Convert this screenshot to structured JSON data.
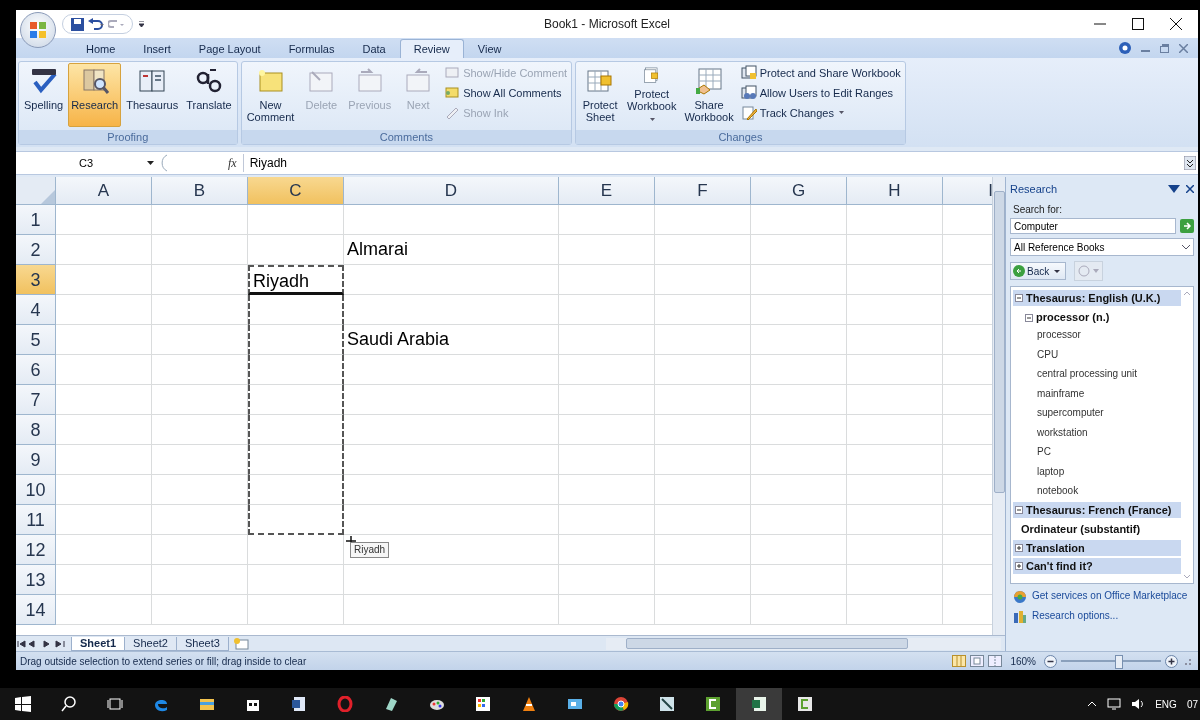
{
  "window": {
    "title": "Book1 - Microsoft Excel"
  },
  "ribbon_tabs": [
    {
      "label": "Home",
      "selected": false
    },
    {
      "label": "Insert",
      "selected": false
    },
    {
      "label": "Page Layout",
      "selected": false
    },
    {
      "label": "Formulas",
      "selected": false
    },
    {
      "label": "Data",
      "selected": false
    },
    {
      "label": "Review",
      "selected": true
    },
    {
      "label": "View",
      "selected": false
    }
  ],
  "ribbon_groups": [
    {
      "label": "Proofing",
      "items": [
        {
          "kind": "large",
          "label": "Spelling",
          "selected": false,
          "disabled": false,
          "has_menu": false
        },
        {
          "kind": "large",
          "label": "Research",
          "selected": true,
          "disabled": false,
          "has_menu": false
        },
        {
          "kind": "large",
          "label": "Thesaurus",
          "selected": false,
          "disabled": false,
          "has_menu": false
        },
        {
          "kind": "large",
          "label": "Translate",
          "selected": false,
          "disabled": false,
          "has_menu": false
        }
      ]
    },
    {
      "label": "Comments",
      "items": [
        {
          "kind": "large",
          "label": "New Comment",
          "selected": false,
          "disabled": false,
          "has_menu": false
        },
        {
          "kind": "large",
          "label": "Delete",
          "selected": false,
          "disabled": true,
          "has_menu": false
        },
        {
          "kind": "large",
          "label": "Previous",
          "selected": false,
          "disabled": true,
          "has_menu": false
        },
        {
          "kind": "large",
          "label": "Next",
          "selected": false,
          "disabled": true,
          "has_menu": false
        },
        {
          "kind": "small",
          "label": "Show/Hide Comment",
          "selected": false,
          "disabled": true,
          "has_menu": false
        },
        {
          "kind": "small",
          "label": "Show All Comments",
          "selected": false,
          "disabled": false,
          "has_menu": false
        },
        {
          "kind": "small",
          "label": "Show Ink",
          "selected": false,
          "disabled": true,
          "has_menu": false
        }
      ]
    },
    {
      "label": "Changes",
      "items": [
        {
          "kind": "large",
          "label": "Protect Sheet",
          "selected": false,
          "disabled": false,
          "has_menu": false
        },
        {
          "kind": "large",
          "label": "Protect Workbook",
          "selected": false,
          "disabled": false,
          "has_menu": true
        },
        {
          "kind": "large",
          "label": "Share Workbook",
          "selected": false,
          "disabled": false,
          "has_menu": false
        },
        {
          "kind": "small",
          "label": "Protect and Share Workbook",
          "selected": false,
          "disabled": false,
          "has_menu": false
        },
        {
          "kind": "small",
          "label": "Allow Users to Edit Ranges",
          "selected": false,
          "disabled": false,
          "has_menu": false
        },
        {
          "kind": "small",
          "label": "Track Changes",
          "selected": false,
          "disabled": false,
          "has_menu": true
        }
      ]
    }
  ],
  "formula_bar": {
    "name_box": "C3",
    "function_label": "fx",
    "value": "Riyadh"
  },
  "sheet": {
    "columns": [
      {
        "label": "A",
        "selected": false
      },
      {
        "label": "B",
        "selected": false
      },
      {
        "label": "C",
        "selected": true
      },
      {
        "label": "D",
        "selected": false
      },
      {
        "label": "E",
        "selected": false
      },
      {
        "label": "F",
        "selected": false
      },
      {
        "label": "G",
        "selected": false
      },
      {
        "label": "H",
        "selected": false
      },
      {
        "label": "I",
        "selected": false
      }
    ],
    "rows": [
      {
        "label": "1",
        "selected": false,
        "in_fill_range": false
      },
      {
        "label": "2",
        "selected": false,
        "in_fill_range": false,
        "cells": [
          null,
          null,
          null,
          "Almarai"
        ]
      },
      {
        "label": "3",
        "selected": true,
        "in_fill_range": true,
        "cells": [
          null,
          null,
          "Riyadh"
        ]
      },
      {
        "label": "4",
        "selected": false,
        "in_fill_range": true
      },
      {
        "label": "5",
        "selected": false,
        "in_fill_range": true,
        "cells": [
          null,
          null,
          null,
          "Saudi Arabia"
        ]
      },
      {
        "label": "6",
        "selected": false,
        "in_fill_range": true
      },
      {
        "label": "7",
        "selected": false,
        "in_fill_range": true
      },
      {
        "label": "8",
        "selected": false,
        "in_fill_range": true
      },
      {
        "label": "9",
        "selected": false,
        "in_fill_range": true
      },
      {
        "label": "10",
        "selected": false,
        "in_fill_range": true
      },
      {
        "label": "11",
        "selected": false,
        "in_fill_range": true
      },
      {
        "label": "12",
        "selected": false,
        "in_fill_range": false
      },
      {
        "label": "13",
        "selected": false,
        "in_fill_range": false
      },
      {
        "label": "14",
        "selected": false,
        "in_fill_range": false
      }
    ],
    "drag_tooltip": {
      "text": "Riyadh"
    }
  },
  "sheet_tabs": [
    {
      "label": "Sheet1",
      "selected": true
    },
    {
      "label": "Sheet2",
      "selected": false
    },
    {
      "label": "Sheet3",
      "selected": false
    }
  ],
  "status_bar": {
    "message": "Drag outside selection to extend series or fill; drag inside to clear",
    "zoom": "160%",
    "zoom_slider": {
      "level": 0.58
    }
  },
  "research_pane": {
    "title": "Research",
    "search_label": "Search for:",
    "query": "Computer",
    "source": "All Reference Books",
    "back_label": "Back",
    "results": [
      {
        "label": "Thesaurus: English (U.K.)",
        "expanded": true,
        "children": [
          {
            "label": "processor (n.)",
            "expanded": true,
            "children": [
              {
                "label": "processor"
              },
              {
                "label": "CPU"
              },
              {
                "label": "central processing unit"
              },
              {
                "label": "mainframe"
              },
              {
                "label": "supercomputer"
              },
              {
                "label": "workstation"
              },
              {
                "label": "PC"
              },
              {
                "label": "laptop"
              },
              {
                "label": "notebook"
              }
            ]
          }
        ]
      },
      {
        "label": "Thesaurus: French (France)",
        "expanded": true,
        "children": [
          {
            "label": "Ordinateur (substantif)"
          }
        ]
      },
      {
        "label": "Translation",
        "expanded": false
      },
      {
        "label": "Can't find it?",
        "expanded": false
      }
    ],
    "links": [
      "Get services on Office Marketplace",
      "Research options..."
    ]
  },
  "taskbar": {
    "language": "ENG",
    "clock": "07"
  }
}
